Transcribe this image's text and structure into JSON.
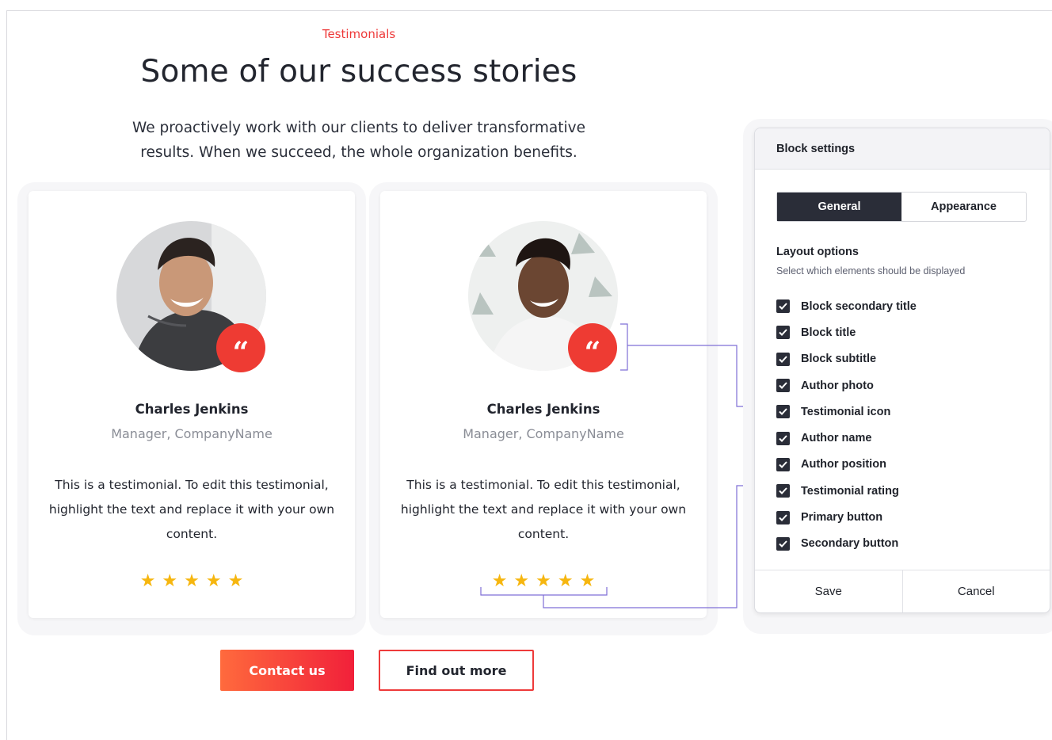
{
  "section": {
    "secondary_title": "Testimonials",
    "title": "Some of our success stories",
    "subtitle": "We proactively work with our clients to deliver transformative results. When we succeed, the whole organization benefits."
  },
  "testimonials": [
    {
      "author_name": "Charles Jenkins",
      "author_position": "Manager, CompanyName",
      "text": "This is a testimonial. To edit this testimonial, highlight the text and replace it with your own content.",
      "rating": 5,
      "rating_stars": "★★★★★",
      "quote_icon": "quote-icon"
    },
    {
      "author_name": "Charles Jenkins",
      "author_position": "Manager, CompanyName",
      "text": "This is a testimonial. To edit this testimonial, highlight the text and replace it with your own content.",
      "rating": 5,
      "rating_stars": "★★★★★",
      "quote_icon": "quote-icon"
    }
  ],
  "buttons": {
    "primary": "Contact us",
    "secondary": "Find out more"
  },
  "block_settings": {
    "header": "Block settings",
    "tabs": [
      {
        "label": "General",
        "active": true
      },
      {
        "label": "Appearance",
        "active": false
      }
    ],
    "layout_title": "Layout options",
    "layout_description": "Select which elements should be displayed",
    "options": [
      {
        "label": "Block secondary title",
        "checked": true
      },
      {
        "label": "Block title",
        "checked": true
      },
      {
        "label": "Block subtitle",
        "checked": true
      },
      {
        "label": "Author photo",
        "checked": true
      },
      {
        "label": "Testimonial icon",
        "checked": true
      },
      {
        "label": "Author name",
        "checked": true
      },
      {
        "label": "Author position",
        "checked": true
      },
      {
        "label": "Testimonial rating",
        "checked": true
      },
      {
        "label": "Primary button",
        "checked": true
      },
      {
        "label": "Secondary button",
        "checked": true
      }
    ],
    "save_label": "Save",
    "cancel_label": "Cancel"
  },
  "colors": {
    "accent": "#ee3a3a",
    "star": "#f6b60f",
    "dark": "#2a2d38",
    "connector": "#7f6fd6"
  }
}
